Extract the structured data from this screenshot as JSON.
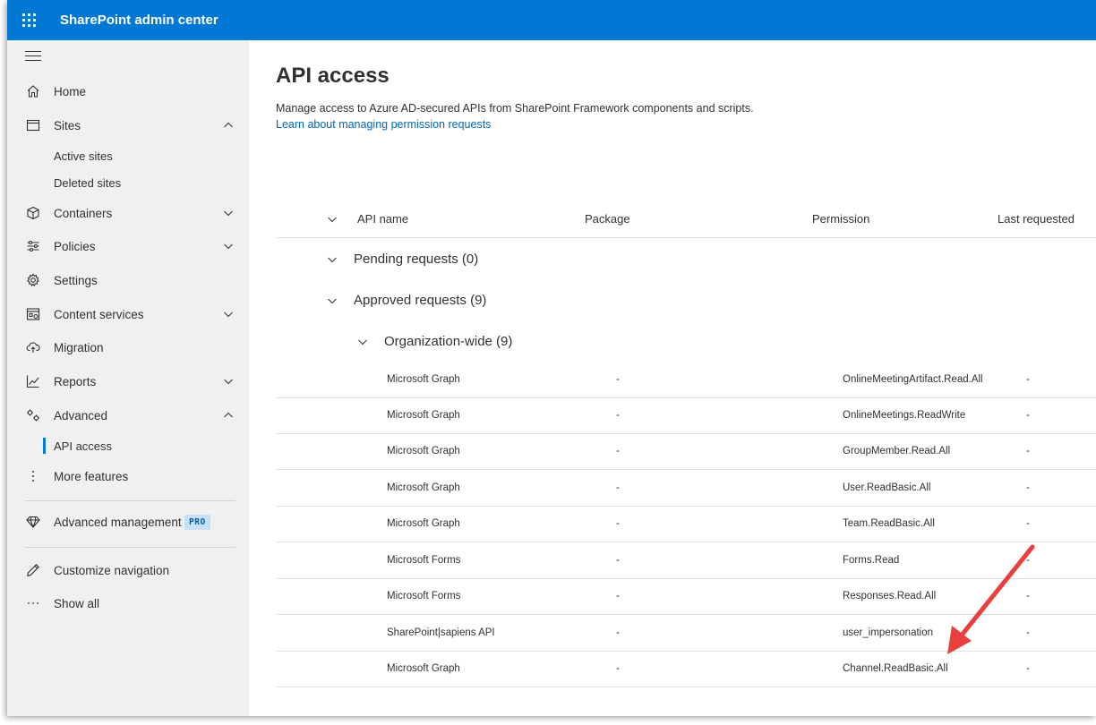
{
  "app": {
    "title": "SharePoint admin center"
  },
  "sidebar": {
    "items": [
      {
        "label": "Home"
      },
      {
        "label": "Sites"
      },
      {
        "label": "Active sites"
      },
      {
        "label": "Deleted sites"
      },
      {
        "label": "Containers"
      },
      {
        "label": "Policies"
      },
      {
        "label": "Settings"
      },
      {
        "label": "Content services"
      },
      {
        "label": "Migration"
      },
      {
        "label": "Reports"
      },
      {
        "label": "Advanced"
      },
      {
        "label": "API access"
      },
      {
        "label": "More features"
      },
      {
        "label": "Advanced management"
      },
      {
        "label": "Customize navigation"
      },
      {
        "label": "Show all"
      }
    ],
    "pro_badge": "PRO"
  },
  "main": {
    "title": "API access",
    "description": "Manage access to Azure AD-secured APIs from SharePoint Framework components and scripts.",
    "link": "Learn about managing permission requests",
    "columns": [
      "API name",
      "Package",
      "Permission",
      "Last requested"
    ],
    "groups": {
      "pending": "Pending requests (0)",
      "approved": "Approved requests (9)",
      "org_wide": "Organization-wide (9)"
    },
    "rows": [
      {
        "api": "Microsoft Graph",
        "package": "-",
        "permission": "OnlineMeetingArtifact.Read.All",
        "last": "-"
      },
      {
        "api": "Microsoft Graph",
        "package": "-",
        "permission": "OnlineMeetings.ReadWrite",
        "last": "-"
      },
      {
        "api": "Microsoft Graph",
        "package": "-",
        "permission": "GroupMember.Read.All",
        "last": "-"
      },
      {
        "api": "Microsoft Graph",
        "package": "-",
        "permission": "User.ReadBasic.All",
        "last": "-"
      },
      {
        "api": "Microsoft Graph",
        "package": "-",
        "permission": "Team.ReadBasic.All",
        "last": "-"
      },
      {
        "api": "Microsoft Forms",
        "package": "-",
        "permission": "Forms.Read",
        "last": "-"
      },
      {
        "api": "Microsoft Forms",
        "package": "-",
        "permission": "Responses.Read.All",
        "last": "-"
      },
      {
        "api": "SharePoint|sapiens API",
        "package": "-",
        "permission": "user_impersonation",
        "last": "-"
      },
      {
        "api": "Microsoft Graph",
        "package": "-",
        "permission": "Channel.ReadBasic.All",
        "last": "-"
      }
    ]
  },
  "colors": {
    "brand": "#0078d4",
    "arrow": "#e8403f",
    "sidebar_bg": "#f0f0f0"
  },
  "icons": [
    "waffle-icon",
    "hamburger-icon",
    "home-icon",
    "sites-icon",
    "containers-icon",
    "policies-icon",
    "settings-icon",
    "content-services-icon",
    "migration-icon",
    "reports-icon",
    "advanced-icon",
    "more-icon",
    "diamond-icon",
    "pencil-icon",
    "ellipsis-icon",
    "chevron-up-icon",
    "chevron-down-icon"
  ]
}
